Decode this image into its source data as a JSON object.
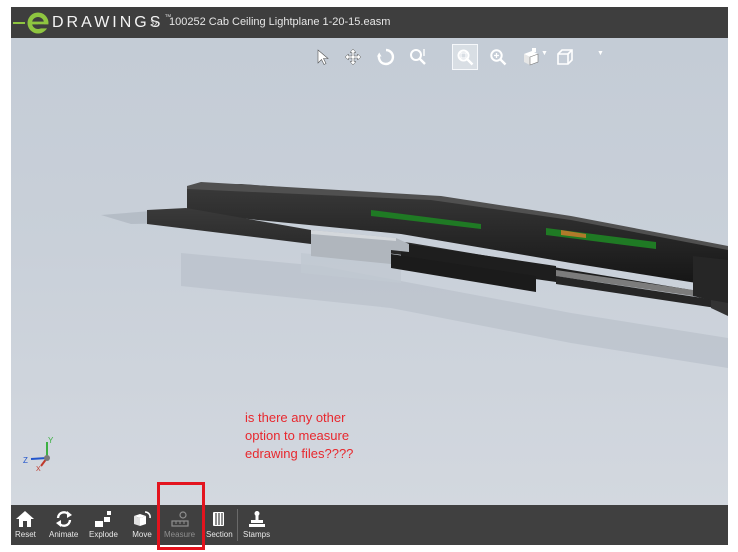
{
  "app": {
    "brand_text": "DRAWINGS",
    "brand_tm": "™",
    "separator": "»",
    "file_name": "100252 Cab Ceiling Lightplane 1-20-15.easm"
  },
  "view_toolbar": [
    {
      "name": "select-tool",
      "icon": "pointer-icon",
      "active": false
    },
    {
      "name": "pan-tool",
      "icon": "move-arrows-icon",
      "active": false
    },
    {
      "name": "rotate-tool",
      "icon": "rotate-icon",
      "active": false
    },
    {
      "name": "zoom-tool",
      "icon": "zoom-icon",
      "active": false
    },
    {
      "name": "zoom-to-area-tool",
      "icon": "zoom-area-icon",
      "active": true
    },
    {
      "name": "zoom-to-fit-tool",
      "icon": "zoom-fit-icon",
      "active": false
    },
    {
      "name": "standard-views-dropdown",
      "icon": "view-orientation-icon",
      "active": false
    },
    {
      "name": "display-style-dropdown",
      "icon": "cube-icon",
      "active": false
    }
  ],
  "triad": {
    "x_label": "X",
    "y_label": "Y",
    "z_label": "Z"
  },
  "annotation": {
    "lines": [
      "is there any other",
      "option to measure",
      "edrawing files????"
    ],
    "color": "#e8282e"
  },
  "bottom_toolbar": [
    {
      "label": "Reset",
      "icon": "home-icon",
      "enabled": true
    },
    {
      "label": "Animate",
      "icon": "animate-icon",
      "enabled": true
    },
    {
      "label": "Explode",
      "icon": "explode-icon",
      "enabled": true
    },
    {
      "label": "Move",
      "icon": "move-icon",
      "enabled": true
    },
    {
      "label": "Measure",
      "icon": "measure-icon",
      "enabled": false
    },
    {
      "label": "Section",
      "icon": "section-icon",
      "enabled": true
    },
    {
      "label": "Stamps",
      "icon": "stamps-icon",
      "enabled": true
    }
  ],
  "colors": {
    "titlebar": "#3e3e3e",
    "bottombar": "#404040",
    "brand_green": "#8ec540",
    "highlight_box": "#e3141e"
  }
}
